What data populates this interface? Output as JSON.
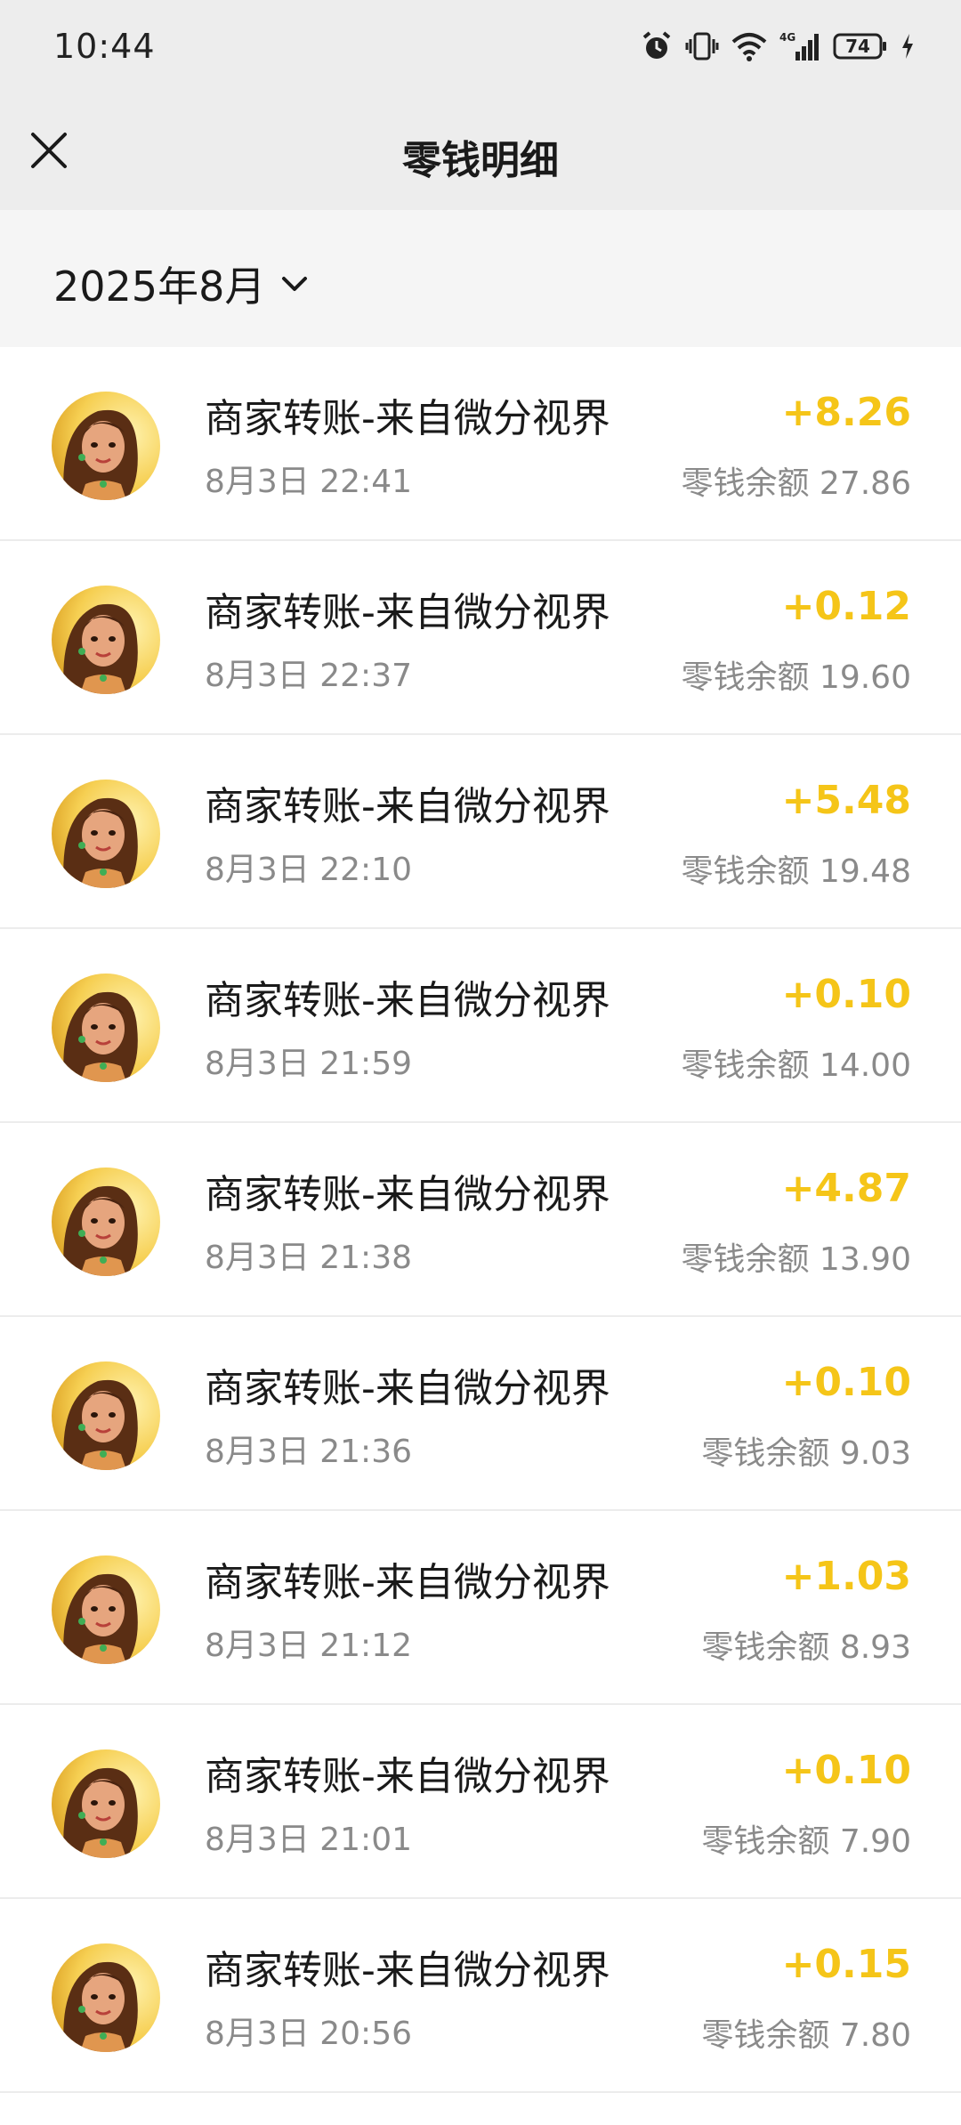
{
  "status_bar": {
    "time": "10:44",
    "network": "4G",
    "battery": "74",
    "icons": [
      "alarm-icon",
      "vibrate-icon",
      "wifi-icon",
      "signal-icon",
      "battery-icon",
      "charging-icon"
    ]
  },
  "nav": {
    "title": "零钱明细",
    "close_icon": "close-icon"
  },
  "filter": {
    "month": "2025年8月",
    "dropdown_icon": "chevron-down-icon"
  },
  "colors": {
    "amount": "#f5c518",
    "background_header": "#ededed",
    "background_filter": "#f5f5f5"
  },
  "transactions": [
    {
      "title": "商家转账-来自微分视界",
      "time": "8月3日 22:41",
      "amount": "+8.26",
      "balance": "零钱余额 27.86"
    },
    {
      "title": "商家转账-来自微分视界",
      "time": "8月3日 22:37",
      "amount": "+0.12",
      "balance": "零钱余额 19.60"
    },
    {
      "title": "商家转账-来自微分视界",
      "time": "8月3日 22:10",
      "amount": "+5.48",
      "balance": "零钱余额 19.48"
    },
    {
      "title": "商家转账-来自微分视界",
      "time": "8月3日 21:59",
      "amount": "+0.10",
      "balance": "零钱余额 14.00"
    },
    {
      "title": "商家转账-来自微分视界",
      "time": "8月3日 21:38",
      "amount": "+4.87",
      "balance": "零钱余额 13.90"
    },
    {
      "title": "商家转账-来自微分视界",
      "time": "8月3日 21:36",
      "amount": "+0.10",
      "balance": "零钱余额 9.03"
    },
    {
      "title": "商家转账-来自微分视界",
      "time": "8月3日 21:12",
      "amount": "+1.03",
      "balance": "零钱余额 8.93"
    },
    {
      "title": "商家转账-来自微分视界",
      "time": "8月3日 21:01",
      "amount": "+0.10",
      "balance": "零钱余额 7.90"
    },
    {
      "title": "商家转账-来自微分视界",
      "time": "8月3日 20:56",
      "amount": "+0.15",
      "balance": "零钱余额 7.80"
    }
  ]
}
